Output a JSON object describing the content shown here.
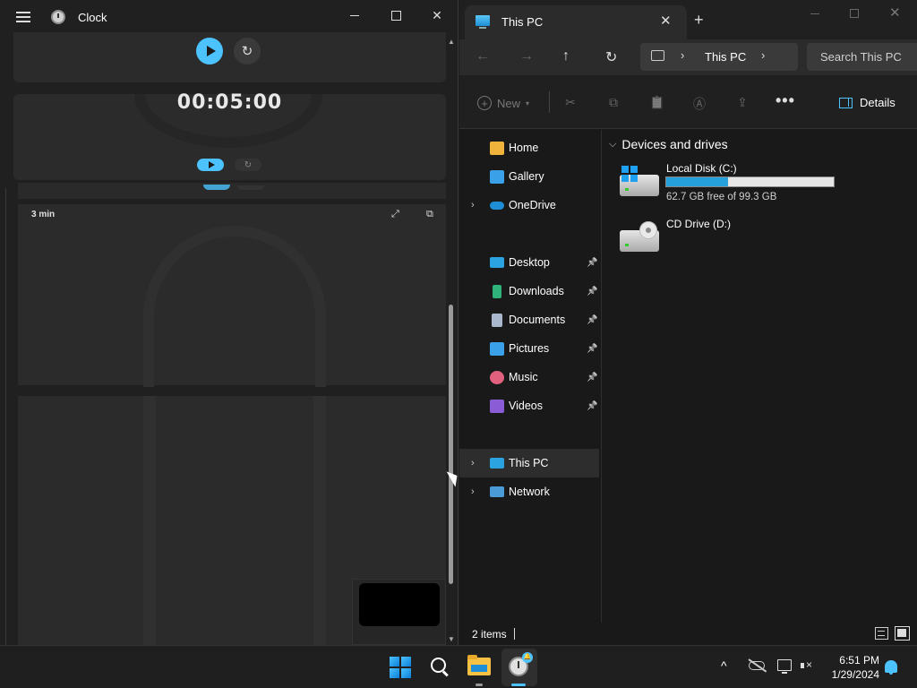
{
  "clock": {
    "title": "Clock",
    "timer_display": "00:05:00",
    "timer_label": "3 min",
    "reset_glyph": "↻",
    "expand_glyph": "⤢",
    "compact_glyph": "⧉",
    "close_glyph": "✕",
    "scroll_up_glyph": "▲",
    "scroll_down_glyph": "▼"
  },
  "explorer": {
    "tab_title": "This PC",
    "tab_close_glyph": "✕",
    "new_tab_glyph": "+",
    "close_glyph": "✕",
    "nav": {
      "back_glyph": "←",
      "forward_glyph": "→",
      "up_glyph": "↑",
      "refresh_glyph": "↻",
      "chevron_glyph": "›"
    },
    "address": {
      "location": "This PC"
    },
    "search": {
      "placeholder": "Search This PC"
    },
    "commands": {
      "new_label": "New",
      "new_plus_glyph": "+",
      "new_caret_glyph": "▾",
      "more_glyph": "•••",
      "details_label": "Details",
      "cut_glyph": "✂",
      "copy_glyph": "⧉",
      "paste_glyph": "📋",
      "rename_glyph": "Ⓐ",
      "share_glyph": "⇪"
    },
    "sidebar": {
      "chevron_glyph": "›",
      "pin_glyph": "📌",
      "items": [
        {
          "label": "Home",
          "color": "#f0b43c"
        },
        {
          "label": "Gallery",
          "color": "#3aa0e8"
        },
        {
          "label": "OneDrive",
          "color": "#1e8fd6"
        },
        {
          "label": "Desktop",
          "color": "#2aa3e0"
        },
        {
          "label": "Downloads",
          "color": "#2fb37a"
        },
        {
          "label": "Documents",
          "color": "#a9b8cc"
        },
        {
          "label": "Pictures",
          "color": "#3aa0e8"
        },
        {
          "label": "Music",
          "color": "#e0607e"
        },
        {
          "label": "Videos",
          "color": "#8a5cd6"
        },
        {
          "label": "This PC",
          "color": "#2aa3e0"
        },
        {
          "label": "Network",
          "color": "#4b9bd6"
        }
      ]
    },
    "group": {
      "title": "Devices and drives",
      "chevron_glyph": "⌵"
    },
    "drives": [
      {
        "name": "Local Disk (C:)",
        "free_text": "62.7 GB free of 99.3 GB",
        "used_fraction": 0.369
      },
      {
        "name": "CD Drive (D:)"
      }
    ],
    "status": {
      "item_count": "2 items"
    }
  },
  "taskbar": {
    "clock_badge": "🔔",
    "time": "6:51 PM",
    "date": "1/29/2024",
    "chevron_glyph": "^"
  },
  "colors": {
    "accent": "#4cc2ff",
    "drive_fill": "#26a0da"
  }
}
